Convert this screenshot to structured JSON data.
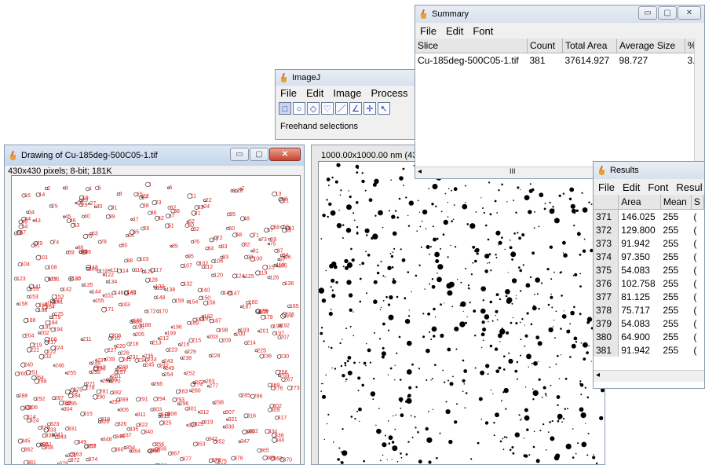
{
  "drawing_window": {
    "title": "Drawing of Cu-185deg-500C05-1.tif",
    "info": "430x430 pixels; 8-bit; 181K"
  },
  "image_window": {
    "info": "1000.00x1000.00 nm (430"
  },
  "imagej": {
    "title": "ImageJ",
    "menu": [
      "File",
      "Edit",
      "Image",
      "Process",
      "A"
    ],
    "status": "Freehand selections"
  },
  "summary": {
    "title": "Summary",
    "menu": [
      "File",
      "Edit",
      "Font"
    ],
    "headers": [
      "Slice",
      "Count",
      "Total Area",
      "Average Size",
      "%"
    ],
    "rows": [
      [
        "Cu-185deg-500C05-1.tif",
        "381",
        "37614.927",
        "98.727",
        "3."
      ]
    ],
    "scroll_mark": "III"
  },
  "results": {
    "title": "Results",
    "menu": [
      "File",
      "Edit",
      "Font",
      "Resul"
    ],
    "headers": [
      "",
      "Area",
      "Mean",
      "S"
    ],
    "rows": [
      [
        "371",
        "146.025",
        "255",
        "("
      ],
      [
        "372",
        "129.800",
        "255",
        "("
      ],
      [
        "373",
        "91.942",
        "255",
        "("
      ],
      [
        "374",
        "97.350",
        "255",
        "("
      ],
      [
        "375",
        "54.083",
        "255",
        "("
      ],
      [
        "376",
        "102.758",
        "255",
        "("
      ],
      [
        "377",
        "81.125",
        "255",
        "("
      ],
      [
        "378",
        "75.717",
        "255",
        "("
      ],
      [
        "379",
        "54.083",
        "255",
        "("
      ],
      [
        "380",
        "64.900",
        "255",
        "("
      ],
      [
        "381",
        "91.942",
        "255",
        "("
      ]
    ]
  },
  "window_buttons": {
    "minimize": "▭",
    "maximize": "▢",
    "close": "✕"
  },
  "colors": {
    "label_red": "#e02020",
    "particle_black": "#000000"
  }
}
